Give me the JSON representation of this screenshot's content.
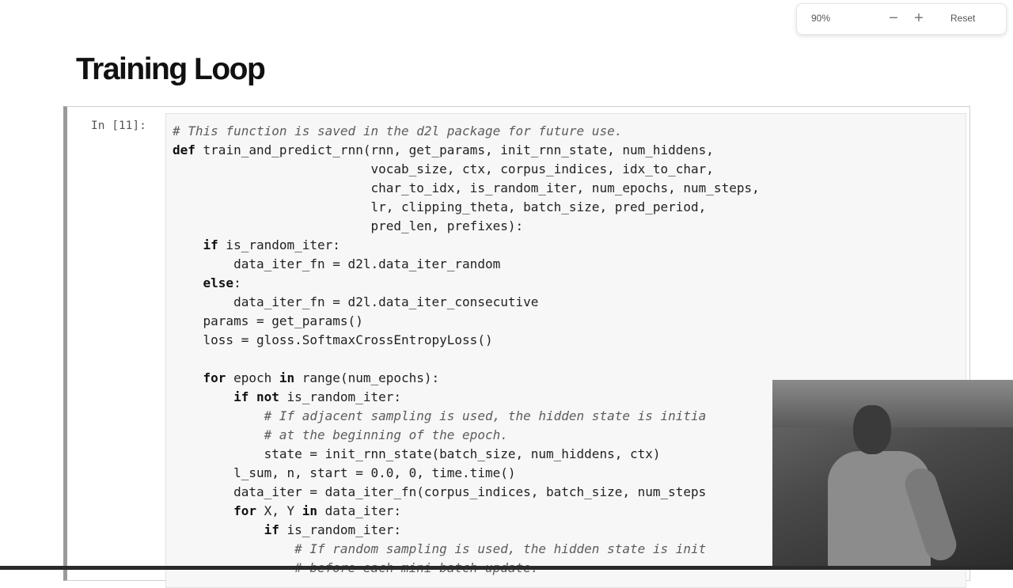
{
  "zoom": {
    "level": "90%",
    "zoom_out": "−",
    "zoom_in": "+",
    "reset": "Reset"
  },
  "page_title": "Training Loop",
  "cell": {
    "prompt": "In [11]:",
    "code_lines": [
      [
        {
          "t": "# This function is saved in the d2l package for future use.",
          "c": "cm"
        }
      ],
      [
        {
          "t": "def",
          "c": "kw"
        },
        {
          "t": " train_and_predict_rnn(rnn, get_params, init_rnn_state, num_hiddens,"
        }
      ],
      [
        {
          "t": "                          vocab_size, ctx, corpus_indices, idx_to_char,"
        }
      ],
      [
        {
          "t": "                          char_to_idx, is_random_iter, num_epochs, num_steps,"
        }
      ],
      [
        {
          "t": "                          lr, clipping_theta, batch_size, pred_period,"
        }
      ],
      [
        {
          "t": "                          pred_len, prefixes):"
        }
      ],
      [
        {
          "t": "    "
        },
        {
          "t": "if",
          "c": "kw"
        },
        {
          "t": " is_random_iter:"
        }
      ],
      [
        {
          "t": "        data_iter_fn = d2l.data_iter_random"
        }
      ],
      [
        {
          "t": "    "
        },
        {
          "t": "else",
          "c": "kw"
        },
        {
          "t": ":"
        }
      ],
      [
        {
          "t": "        data_iter_fn = d2l.data_iter_consecutive"
        }
      ],
      [
        {
          "t": "    params = get_params()"
        }
      ],
      [
        {
          "t": "    loss = gloss.SoftmaxCrossEntropyLoss()"
        }
      ],
      [
        {
          "t": ""
        }
      ],
      [
        {
          "t": "    "
        },
        {
          "t": "for",
          "c": "kw"
        },
        {
          "t": " epoch "
        },
        {
          "t": "in",
          "c": "kw"
        },
        {
          "t": " range(num_epochs):"
        }
      ],
      [
        {
          "t": "        "
        },
        {
          "t": "if not",
          "c": "kw"
        },
        {
          "t": " is_random_iter:"
        }
      ],
      [
        {
          "t": "            "
        },
        {
          "t": "# If adjacent sampling is used, the hidden state is initia",
          "c": "cm"
        }
      ],
      [
        {
          "t": "            "
        },
        {
          "t": "# at the beginning of the epoch.",
          "c": "cm"
        }
      ],
      [
        {
          "t": "            state = init_rnn_state(batch_size, num_hiddens, ctx)"
        }
      ],
      [
        {
          "t": "        l_sum, n, start = 0.0, 0, time.time()"
        }
      ],
      [
        {
          "t": "        data_iter = data_iter_fn(corpus_indices, batch_size, num_steps"
        }
      ],
      [
        {
          "t": "        "
        },
        {
          "t": "for",
          "c": "kw"
        },
        {
          "t": " X, Y "
        },
        {
          "t": "in",
          "c": "kw"
        },
        {
          "t": " data_iter:"
        }
      ],
      [
        {
          "t": "            "
        },
        {
          "t": "if",
          "c": "kw"
        },
        {
          "t": " is_random_iter:"
        }
      ],
      [
        {
          "t": "                "
        },
        {
          "t": "# If random sampling is used, the hidden state is init",
          "c": "cm"
        }
      ],
      [
        {
          "t": "                "
        },
        {
          "t": "# before each mini-batch update.",
          "c": "cm"
        }
      ]
    ]
  }
}
